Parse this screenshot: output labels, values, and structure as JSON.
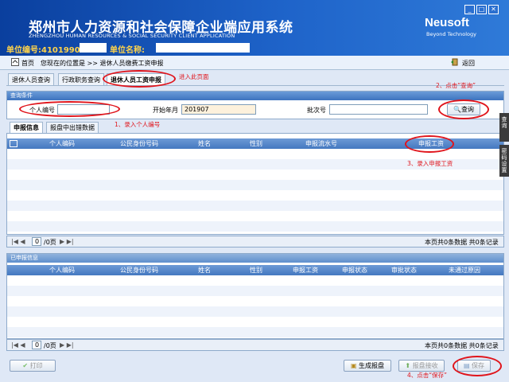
{
  "header": {
    "title_cn": "郑州市人力资源和社会保障企业端应用系统",
    "title_en": "ZHENGZHOU HUMAN RESOURCES & SOCIAL SECURITY CLIENT APPLICATION",
    "logo": "Neusoft",
    "logo_sub": "Beyond Technology",
    "window_buttons": [
      "_",
      "□",
      "✕"
    ],
    "unit_code_label": "单位编号:4101990",
    "unit_name_label": "单位名称:"
  },
  "nav": {
    "home": "首页",
    "location": "您现在的位置是 >> 退休人员缴费工资申报",
    "back": "返回"
  },
  "tabs": [
    {
      "label": "退休人员查询"
    },
    {
      "label": "行政职务查询"
    },
    {
      "label": "退休人员工资申报"
    }
  ],
  "query": {
    "section_title": "查询条件",
    "person_no_label": "个人编号",
    "person_no_value": "",
    "start_month_label": "开始年月",
    "start_month_value": "201907",
    "batch_label": "批次号",
    "batch_value": "",
    "search_button": "查询"
  },
  "subtabs": [
    {
      "label": "申报信息"
    },
    {
      "label": "报盘中出错数据"
    }
  ],
  "table1": {
    "columns": [
      "个人编码",
      "公民身份号码",
      "姓名",
      "性别",
      "申报流水号",
      "申报工资"
    ],
    "pager_page": "0",
    "pager_total": "/0页",
    "summary": "本页共0条数据 共0条记录"
  },
  "table2": {
    "section_title": "已申报信息",
    "columns": [
      "个人编码",
      "公民身份号码",
      "姓名",
      "性别",
      "申报工资",
      "申报状态",
      "审批状态",
      "未通过原因"
    ],
    "pager_page": "0",
    "pager_total": "/0页",
    "summary": "本页共0条数据 共0条记录"
  },
  "footer": {
    "print_button": "打印",
    "generate_button": "生成报盘",
    "receive_button": "报盘接收",
    "save_button": "保存"
  },
  "side_tabs": [
    "查询",
    "密码设置"
  ],
  "annotations": {
    "enter_page": "进入此页面",
    "step1": "1、录入个人编号",
    "step2": "2、点击“查询”",
    "step3": "3、录入申报工资",
    "step4": "4、点击“保存”"
  },
  "colors": {
    "header_blue": "#1e63c9",
    "table_header": "#4f82c6",
    "annotation_red": "#e0141b",
    "unit_yellow": "#ffd34a"
  }
}
